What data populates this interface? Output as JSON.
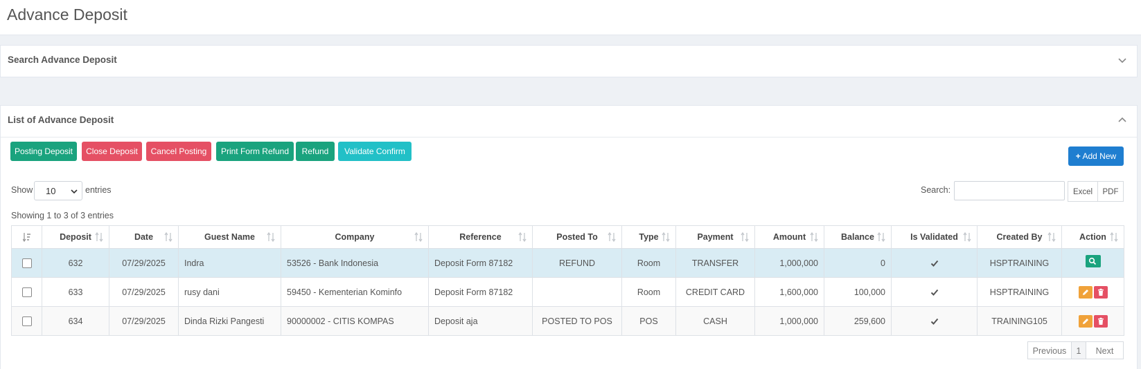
{
  "page": {
    "title": "Advance Deposit"
  },
  "search_panel": {
    "title": "Search Advance Deposit"
  },
  "list_panel": {
    "title": "List of Advance Deposit"
  },
  "actions": {
    "posting_deposit": "Posting Deposit",
    "close_deposit": "Close Deposit",
    "cancel_posting": "Cancel Posting",
    "print_form_refund": "Print Form Refund",
    "refund": "Refund",
    "validate_confirm": "Validate Confirm",
    "add_new": "Add New"
  },
  "length": {
    "show_label": "Show",
    "selected": "10",
    "entries_label": "entries"
  },
  "search": {
    "label": "Search:",
    "value": ""
  },
  "export": {
    "excel": "Excel",
    "pdf": "PDF"
  },
  "info": "Showing 1 to 3 of 3 entries",
  "table": {
    "columns": [
      "Deposit",
      "Date",
      "Guest Name",
      "Company",
      "Reference",
      "Posted To",
      "Type",
      "Payment",
      "Amount",
      "Balance",
      "Is Validated",
      "Created By",
      "Action"
    ],
    "rows": [
      {
        "deposit": "632",
        "date": "07/29/2025",
        "guest": "Indra",
        "company": "53526 - Bank Indonesia",
        "reference": "Deposit Form 87182",
        "posted_to": "REFUND",
        "type": "Room",
        "payment": "TRANSFER",
        "amount": "1,000,000",
        "balance": "0",
        "validated": true,
        "created_by": "HSPTRAINING",
        "actions": [
          "view"
        ],
        "selected": true
      },
      {
        "deposit": "633",
        "date": "07/29/2025",
        "guest": "rusy dani",
        "company": "59450 - Kementerian Kominfo",
        "reference": "Deposit Form 87182",
        "posted_to": "",
        "type": "Room",
        "payment": "CREDIT CARD",
        "amount": "1,600,000",
        "balance": "100,000",
        "validated": true,
        "created_by": "HSPTRAINING",
        "actions": [
          "edit",
          "delete"
        ],
        "selected": false
      },
      {
        "deposit": "634",
        "date": "07/29/2025",
        "guest": "Dinda Rizki Pangesti",
        "company": "90000002 - CITIS KOMPAS",
        "reference": "Deposit aja",
        "posted_to": "POSTED TO POS",
        "type": "POS",
        "payment": "CASH",
        "amount": "1,000,000",
        "balance": "259,600",
        "validated": true,
        "created_by": "TRAINING105",
        "actions": [
          "edit",
          "delete"
        ],
        "selected": false
      }
    ]
  },
  "pagination": {
    "previous": "Previous",
    "current": "1",
    "next": "Next"
  },
  "colors": {
    "green": "#1aa37e",
    "red": "#e55064",
    "cyan": "#22c0c7",
    "blue": "#1f7ed0",
    "orange": "#f0a23a",
    "selected_row": "#d9ecf4"
  }
}
